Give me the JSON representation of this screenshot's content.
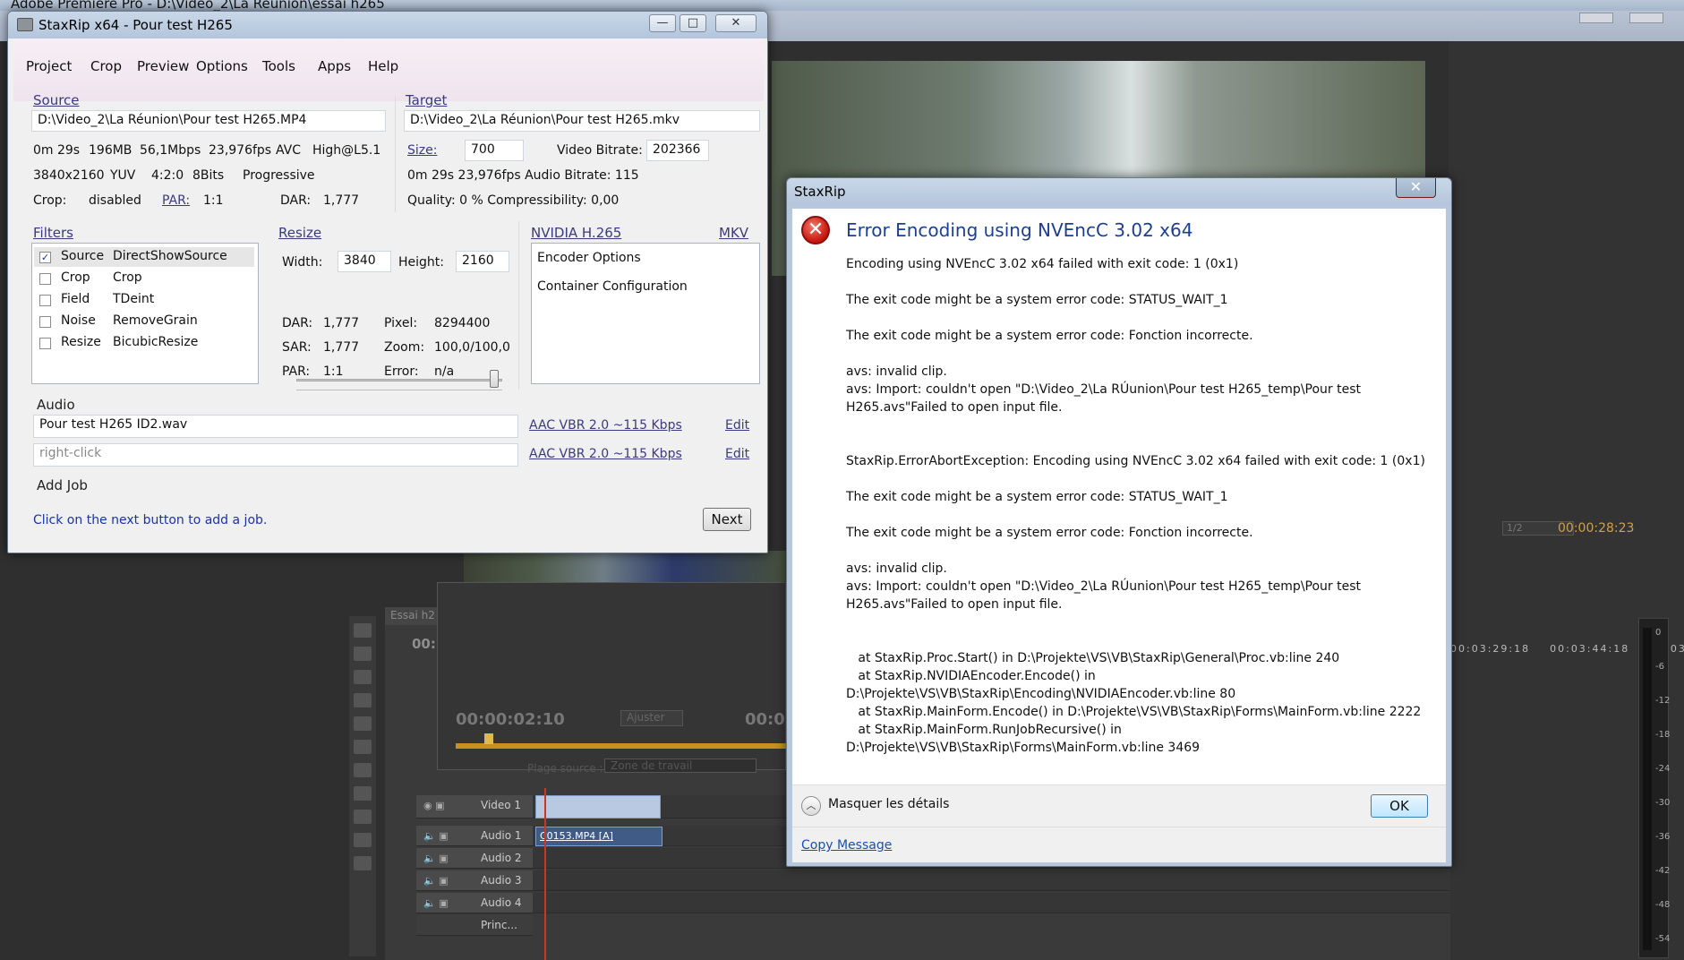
{
  "premiere": {
    "title": "Adobe Premiere Pro - D:\\Video_2\\La Réunion\\essai h265",
    "timecode_right": "00:00:28:23",
    "zoom_select": "1/2",
    "ruler_times": [
      "00:03:29:18",
      "00:03:44:18",
      "00:03:5"
    ],
    "meter_ticks": [
      "0",
      "-6",
      "-12",
      "-18",
      "-24",
      "-30",
      "-36",
      "-42",
      "-48",
      "-54"
    ],
    "source_timecode": "00:00:02:10",
    "source_timecode2": "00:0",
    "fit_label": "Ajuster",
    "range_label": "Plage source :",
    "range_value": "Zone de travail",
    "sequence_tab": "Essai h2",
    "sequence_tc": "00:",
    "tracks": [
      {
        "name": "Video 1",
        "lane_clip": "C0153.MP4"
      },
      {
        "name": "Audio 1",
        "lane_clip": "C0153.MP4 [A]"
      },
      {
        "name": "Audio 2",
        "lane_clip": ""
      },
      {
        "name": "Audio 3",
        "lane_clip": ""
      },
      {
        "name": "Audio 4",
        "lane_clip": ""
      },
      {
        "name": "Princ...",
        "lane_clip": ""
      }
    ]
  },
  "staxrip": {
    "title": "StaxRip x64 - Pour test H265",
    "window_buttons": {
      "minimize": "—",
      "maximize": "□",
      "close": "✕"
    },
    "menu": [
      "Project",
      "Crop",
      "Preview",
      "Options",
      "Tools",
      "Apps",
      "Help"
    ],
    "source": {
      "label": "Source",
      "path": "D:\\Video_2\\La Réunion\\Pour test H265.MP4",
      "line1": [
        "0m 29s",
        "196MB",
        "56,1Mbps",
        "23,976fps",
        "AVC",
        "High@L5.1"
      ],
      "line2": [
        "3840x2160",
        "YUV",
        "4:2:0",
        "8Bits",
        "Progressive"
      ],
      "crop_label": "Crop:",
      "crop_value": "disabled",
      "par_label": "PAR:",
      "par_value": "1:1",
      "dar_label": "DAR:",
      "dar_value": "1,777"
    },
    "target": {
      "label": "Target",
      "path": "D:\\Video_2\\La Réunion\\Pour test H265.mkv",
      "size_label": "Size:",
      "size_value": "700",
      "video_bitrate_label": "Video Bitrate:",
      "video_bitrate_value": "202366",
      "line2": "0m 29s   23,976fps   Audio Bitrate: 115",
      "line3": "Quality: 0 %    Compressibility: 0,00"
    },
    "filters": {
      "label": "Filters",
      "items": [
        {
          "checked": true,
          "name": "Source",
          "value": "DirectShowSource"
        },
        {
          "checked": false,
          "name": "Crop",
          "value": "Crop"
        },
        {
          "checked": false,
          "name": "Field",
          "value": "TDeint"
        },
        {
          "checked": false,
          "name": "Noise",
          "value": "RemoveGrain"
        },
        {
          "checked": false,
          "name": "Resize",
          "value": "BicubicResize"
        }
      ]
    },
    "resize": {
      "label": "Resize",
      "width_label": "Width:",
      "width_value": "3840",
      "height_label": "Height:",
      "height_value": "2160",
      "slider_level": 0.98,
      "dar_label": "DAR:",
      "dar_value": "1,777",
      "pixel_label": "Pixel:",
      "pixel_value": "8294400",
      "sar_label": "SAR:",
      "sar_value": "1,777",
      "zoom_label": "Zoom:",
      "zoom_value": "100,0/100,0",
      "par_label": "PAR:",
      "par_value": "1:1",
      "error_label": "Error:",
      "error_value": "n/a"
    },
    "encoder": {
      "label": "NVIDIA H.265",
      "container_label": "MKV",
      "items": [
        "Encoder Options",
        "Container Configuration"
      ]
    },
    "audio": {
      "label": "Audio",
      "track1_value": "Pour test H265 ID2.wav",
      "track1_profile": "AAC VBR 2.0 ~115 Kbps",
      "track2_placeholder": "right-click",
      "track2_profile": "AAC VBR 2.0 ~115 Kbps",
      "edit_label": "Edit"
    },
    "add_job": {
      "label": "Add Job",
      "hint": "Click on the next button to add a job.",
      "next_label": "Next"
    }
  },
  "dialog": {
    "title": "StaxRip",
    "close": "✕",
    "icon_glyph": "✕",
    "heading": "Error Encoding using NVEncC 3.02 x64",
    "body": "Encoding using NVEncC 3.02 x64 failed with exit code: 1 (0x1)\n\nThe exit code might be a system error code: STATUS_WAIT_1\n\nThe exit code might be a system error code: Fonction incorrecte.\n\navs: invalid clip.\navs: Import: couldn't open \"D:\\Video_2\\La RÚunion\\Pour test H265_temp\\Pour test H265.avs\"Failed to open input file.\n\n\nStaxRip.ErrorAbortException: Encoding using NVEncC 3.02 x64 failed with exit code: 1 (0x1)\n\nThe exit code might be a system error code: STATUS_WAIT_1\n\nThe exit code might be a system error code: Fonction incorrecte.\n\navs: invalid clip.\navs: Import: couldn't open \"D:\\Video_2\\La RÚunion\\Pour test H265_temp\\Pour test H265.avs\"Failed to open input file.\n\n\n   at StaxRip.Proc.Start() in D:\\Projekte\\VS\\VB\\StaxRip\\General\\Proc.vb:line 240\n   at StaxRip.NVIDIAEncoder.Encode() in D:\\Projekte\\VS\\VB\\StaxRip\\Encoding\\NVIDIAEncoder.vb:line 80\n   at StaxRip.MainForm.Encode() in D:\\Projekte\\VS\\VB\\StaxRip\\Forms\\MainForm.vb:line 2222\n   at StaxRip.MainForm.RunJobRecursive() in D:\\Projekte\\VS\\VB\\StaxRip\\Forms\\MainForm.vb:line 3469",
    "details_toggle_icon": "︿",
    "details_label": "Masquer les détails",
    "ok_label": "OK",
    "copy_label": "Copy Message"
  }
}
